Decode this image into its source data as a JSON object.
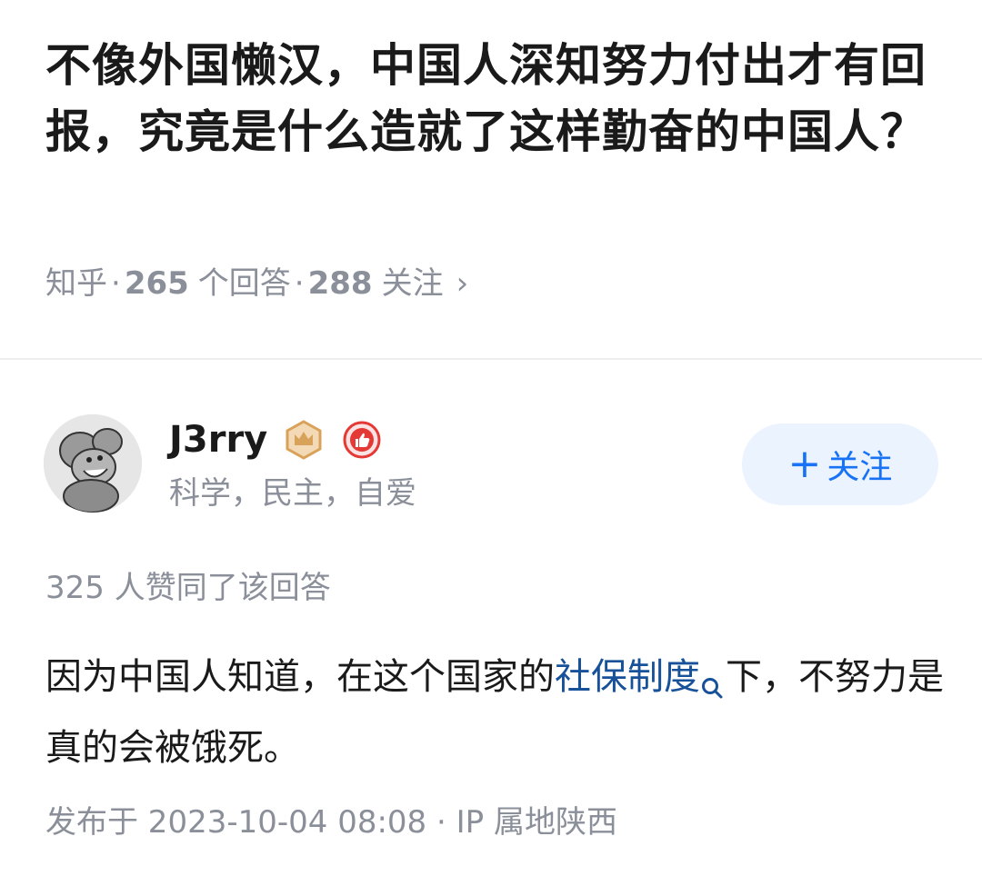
{
  "question": {
    "title": "不像外国懒汉，中国人深知努力付出才有回报，究竟是什么造就了这样勤奋的中国人？",
    "source": "知乎",
    "answer_count": "265",
    "answer_label": "个回答",
    "follower_count": "288",
    "follower_label": "关注",
    "chevron": "›"
  },
  "author": {
    "name": "J3rry",
    "bio": "科学，民主，自爱",
    "avatar_icon": "tom-and-jerry-avatar",
    "badges": [
      "crown-badge-icon",
      "thumbs-up-badge-icon"
    ],
    "badge_colors": {
      "crown": "#d9a25a",
      "thumbs": "#e53935"
    }
  },
  "follow_button": {
    "icon": "+",
    "label": "关注"
  },
  "answer": {
    "upvote_summary": "325 人赞同了该回答",
    "text_before_link": "因为中国人知道，在这个国家的",
    "link_text": "社保制度",
    "text_after_link": "下，不努力是真的会被饿死。",
    "publish_info": "发布于 2023-10-04 08:08 · IP 属地陕西"
  },
  "colors": {
    "accent": "#1772f6",
    "link": "#175199",
    "muted": "#8a8f99",
    "follow_bg": "#ebf3ff"
  }
}
